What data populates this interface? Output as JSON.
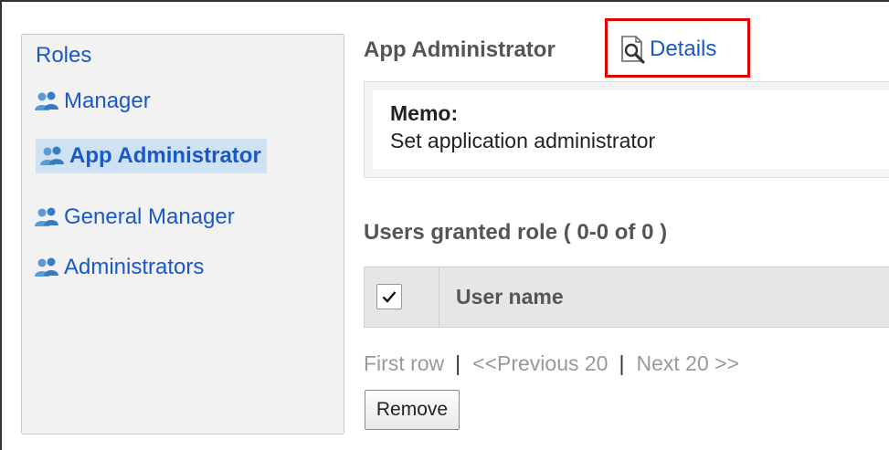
{
  "sidebar": {
    "title": "Roles",
    "items": [
      {
        "label": "Manager",
        "icon": "group-icon",
        "selected": false
      },
      {
        "label": "App Administrator",
        "icon": "group-icon",
        "selected": true
      },
      {
        "label": "General Manager",
        "icon": "group-icon",
        "selected": false
      },
      {
        "label": "Administrators",
        "icon": "group-icon",
        "selected": false
      }
    ]
  },
  "header": {
    "title": "App Administrator",
    "details_label": "Details",
    "details_icon": "magnifier-document-icon",
    "highlight_color": "#e00000"
  },
  "memo": {
    "label": "Memo:",
    "text": "Set application administrator"
  },
  "users": {
    "section_title": "Users granted role ( 0-0 of 0 )",
    "columns": [
      "User name"
    ],
    "select_all_checked": true
  },
  "pagination": {
    "first": "First row",
    "separator": "|",
    "previous": "<<Previous 20",
    "next": "Next 20 >>"
  },
  "actions": {
    "remove_label": "Remove"
  },
  "colors": {
    "link": "#1a57c9",
    "selected_bg": "#cfe2f3",
    "disabled_text": "#999999"
  }
}
